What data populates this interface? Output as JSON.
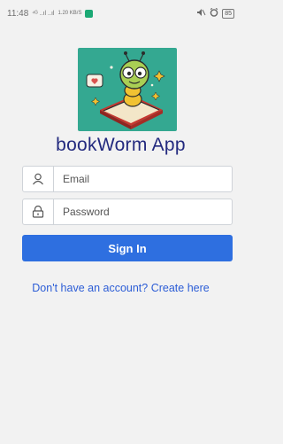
{
  "status_bar": {
    "time": "11:48",
    "network_text": "⁴ᴳ ..ıl ..ıl",
    "speed_text": "1.20 KB/S",
    "battery": "85"
  },
  "app": {
    "title": "bookWorm App",
    "logo_icon": "bookworm-logo",
    "brand_color": "#232a7f",
    "accent_color": "#2e6fe0"
  },
  "form": {
    "email_placeholder": "Email",
    "email_value": "",
    "password_placeholder": "Password",
    "password_value": "",
    "signin_label": "Sign In",
    "create_account_text": "Don't have an account? Create here"
  }
}
